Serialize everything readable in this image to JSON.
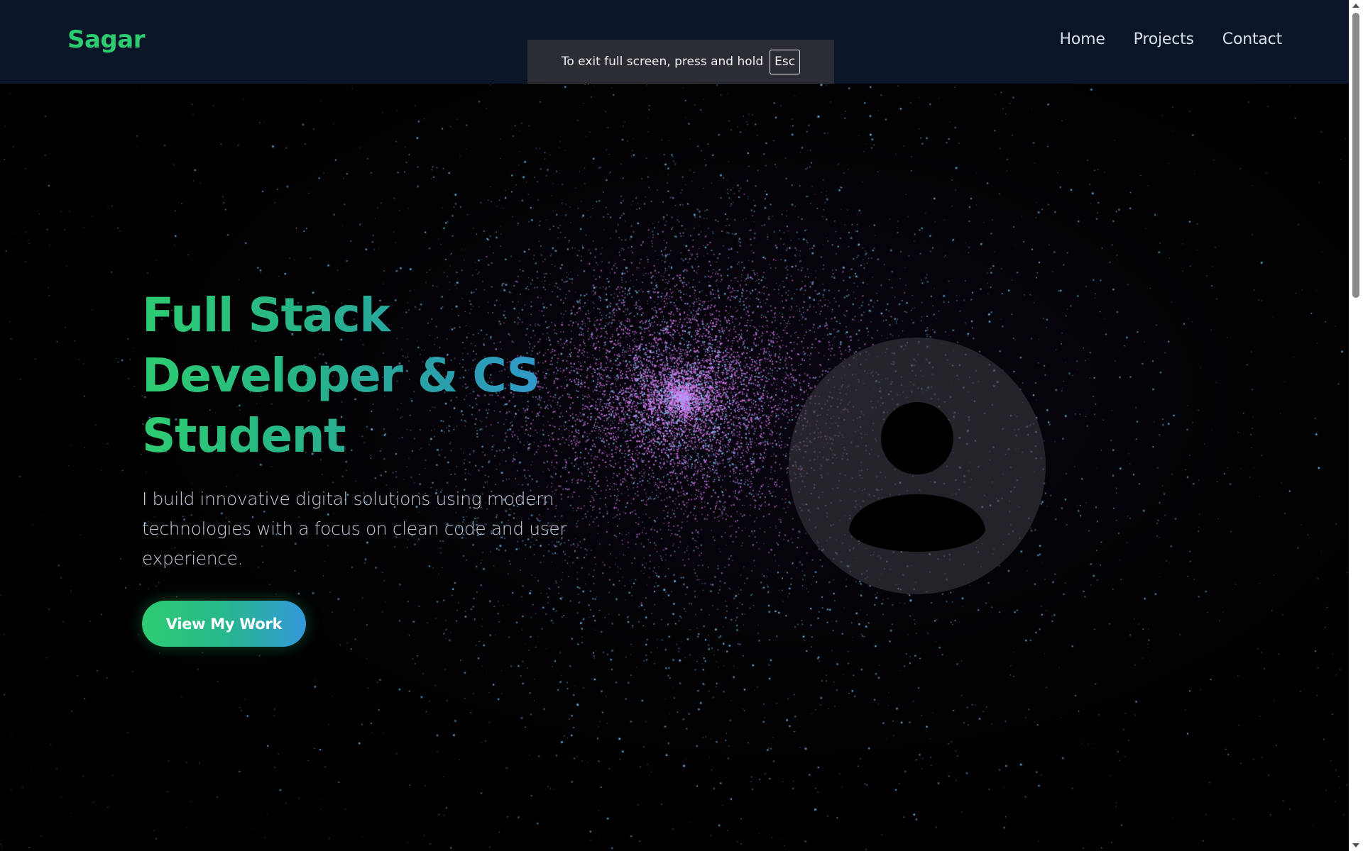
{
  "theme": {
    "brand_color": "#2ecc71",
    "accent_blue": "#3498db",
    "header_bg": "#0a1628",
    "particle_pink": "#d57cf0",
    "particle_blue": "#7fc9ff"
  },
  "header": {
    "brand": "Sagar",
    "nav": [
      {
        "label": "Home"
      },
      {
        "label": "Projects"
      },
      {
        "label": "Contact"
      }
    ]
  },
  "fullscreen_notice": {
    "text": "To exit full screen, press and hold",
    "key": "Esc"
  },
  "hero": {
    "title_lines": [
      "Full Stack",
      "Developer & CS",
      "Student"
    ],
    "subtitle": "I build innovative digital solutions using modern technologies with a focus on clean code and user experience.",
    "cta_label": "View My Work",
    "avatar_icon": "user-avatar-icon"
  },
  "scrollbar": {
    "up_icon": "chevron-up-icon",
    "down_icon": "chevron-down-icon"
  }
}
